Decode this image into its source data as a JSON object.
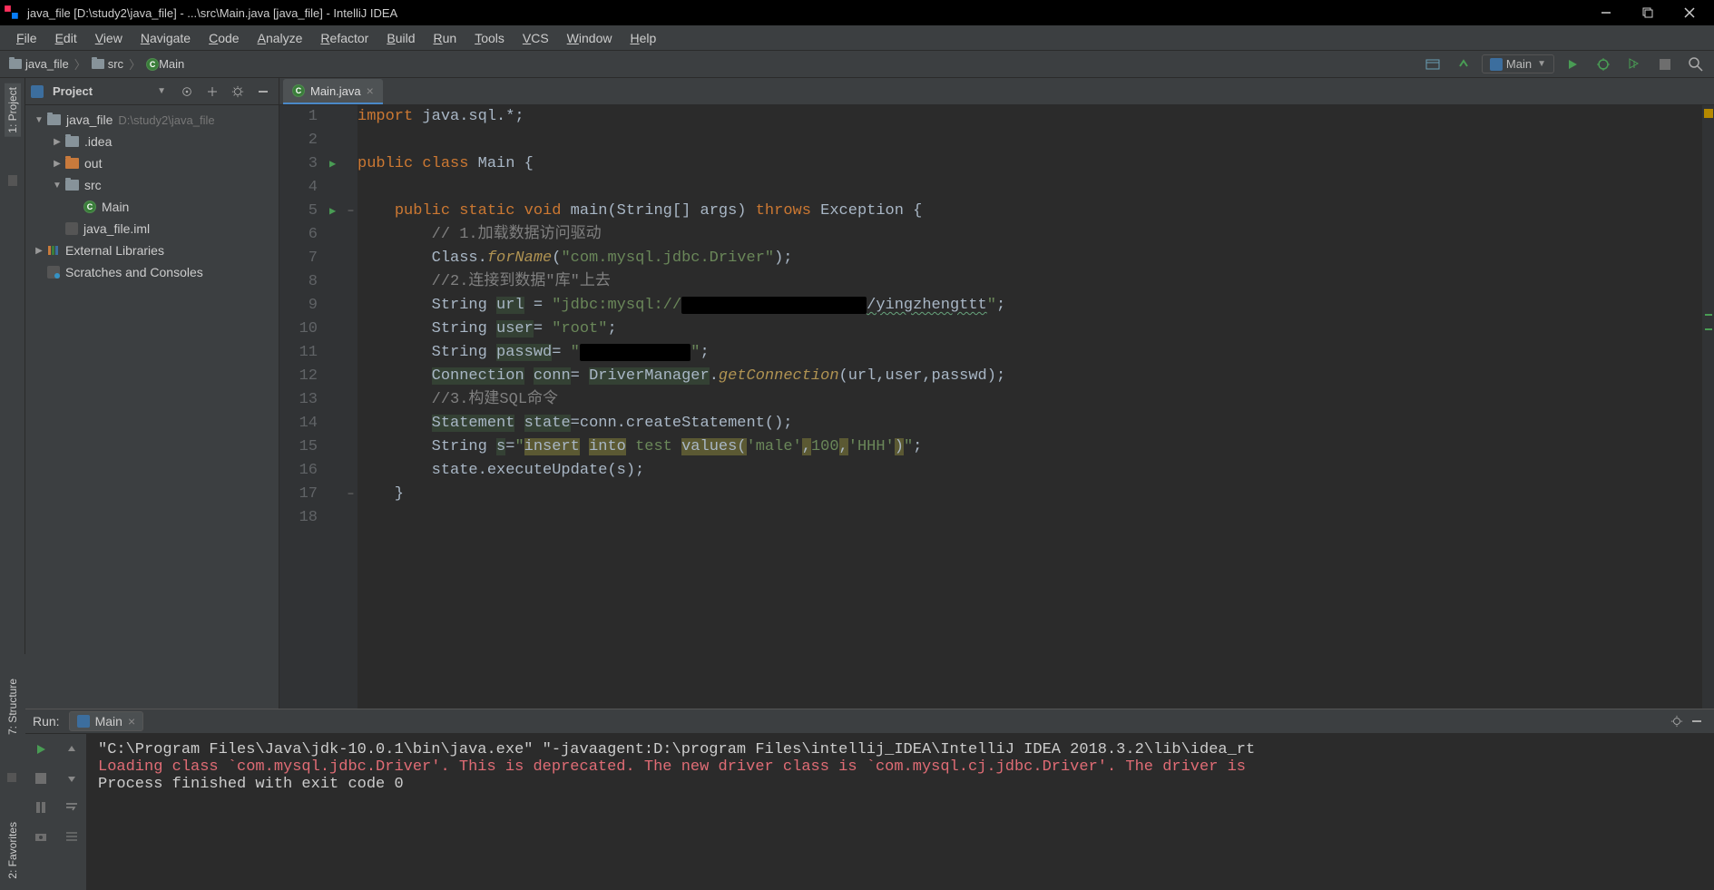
{
  "title": "java_file [D:\\study2\\java_file] - ...\\src\\Main.java [java_file] - IntelliJ IDEA",
  "menu": [
    "File",
    "Edit",
    "View",
    "Navigate",
    "Code",
    "Analyze",
    "Refactor",
    "Build",
    "Run",
    "Tools",
    "VCS",
    "Window",
    "Help"
  ],
  "breadcrumb": [
    {
      "icon": "folder",
      "label": "java_file"
    },
    {
      "icon": "folder",
      "label": "src"
    },
    {
      "icon": "class",
      "label": "Main"
    }
  ],
  "runConfig": "Main",
  "project": {
    "title": "Project",
    "tree": [
      {
        "depth": 0,
        "arrow": "▼",
        "icon": "folder",
        "label": "java_file",
        "suffix": "D:\\study2\\java_file"
      },
      {
        "depth": 1,
        "arrow": "▶",
        "icon": "folder-grey",
        "label": ".idea"
      },
      {
        "depth": 1,
        "arrow": "▶",
        "icon": "folder-orange",
        "label": "out"
      },
      {
        "depth": 1,
        "arrow": "▼",
        "icon": "folder-grey",
        "label": "src"
      },
      {
        "depth": 2,
        "arrow": "",
        "icon": "class",
        "label": "Main"
      },
      {
        "depth": 1,
        "arrow": "",
        "icon": "iml",
        "label": "java_file.iml"
      },
      {
        "depth": 0,
        "arrow": "▶",
        "icon": "lib",
        "label": "External Libraries"
      },
      {
        "depth": 0,
        "arrow": "",
        "icon": "scratch",
        "label": "Scratches and Consoles"
      }
    ]
  },
  "editor": {
    "tab": "Main.java",
    "lines": [
      {
        "n": 1,
        "tokens": [
          [
            "k",
            "import"
          ],
          [
            "",
            " java.sql.*;"
          ]
        ]
      },
      {
        "n": 2,
        "tokens": [
          [
            "",
            ""
          ]
        ]
      },
      {
        "n": 3,
        "run": true,
        "tokens": [
          [
            "k",
            "public"
          ],
          [
            "",
            " "
          ],
          [
            "k",
            "class"
          ],
          [
            "",
            " Main {"
          ]
        ]
      },
      {
        "n": 4,
        "tokens": [
          [
            "",
            ""
          ]
        ]
      },
      {
        "n": 5,
        "run": true,
        "fold": "−",
        "tokens": [
          [
            "",
            "    "
          ],
          [
            "k",
            "public"
          ],
          [
            "",
            " "
          ],
          [
            "k",
            "static"
          ],
          [
            "",
            " "
          ],
          [
            "k",
            "void"
          ],
          [
            "",
            " "
          ],
          [
            "",
            "main"
          ],
          [
            "",
            "(String[] args) "
          ],
          [
            "k",
            "throws"
          ],
          [
            "",
            " Exception {"
          ]
        ]
      },
      {
        "n": 6,
        "tokens": [
          [
            "",
            "        "
          ],
          [
            "cm",
            "// 1.加载数据访问驱动"
          ]
        ]
      },
      {
        "n": 7,
        "tokens": [
          [
            "",
            "        Class."
          ],
          [
            "fn",
            "forName"
          ],
          [
            "",
            "("
          ],
          [
            "st",
            "\"com.mysql.jdbc.Driver\""
          ],
          [
            "",
            ");"
          ]
        ]
      },
      {
        "n": 8,
        "tokens": [
          [
            "",
            "        "
          ],
          [
            "cm",
            "//2.连接到数据\"库\"上去"
          ]
        ]
      },
      {
        "n": 9,
        "tokens": [
          [
            "",
            "        String "
          ],
          [
            "bg-ident",
            "url"
          ],
          [
            "",
            " = "
          ],
          [
            "st",
            "\"jdbc:mysql://"
          ],
          [
            "blk",
            "xxxxxxxxxxxxxxxxxxxx"
          ],
          [
            "wavy",
            "/yingzhengttt"
          ],
          [
            "st",
            "\""
          ],
          [
            "",
            ";"
          ]
        ]
      },
      {
        "n": 10,
        "tokens": [
          [
            "",
            "        String "
          ],
          [
            "bg-ident",
            "user"
          ],
          [
            "",
            "= "
          ],
          [
            "st",
            "\"root\""
          ],
          [
            "",
            ";"
          ]
        ]
      },
      {
        "n": 11,
        "tokens": [
          [
            "",
            "        String "
          ],
          [
            "bg-ident",
            "passwd"
          ],
          [
            "",
            "= "
          ],
          [
            "st",
            "\""
          ],
          [
            "blk",
            "xxxxxxxxxxxx"
          ],
          [
            "st",
            "\""
          ],
          [
            "",
            ";"
          ]
        ]
      },
      {
        "n": 12,
        "tokens": [
          [
            "",
            "        "
          ],
          [
            "bg-ident",
            "Connection"
          ],
          [
            "",
            " "
          ],
          [
            "bg-ident",
            "conn"
          ],
          [
            "",
            "= "
          ],
          [
            "bg-ident",
            "DriverManager"
          ],
          [
            "",
            "."
          ],
          [
            "fn",
            "getConnection"
          ],
          [
            "",
            "(url,user,passwd);"
          ]
        ]
      },
      {
        "n": 13,
        "tokens": [
          [
            "",
            "        "
          ],
          [
            "cm",
            "//3.构建SQL命令"
          ]
        ]
      },
      {
        "n": 14,
        "tokens": [
          [
            "",
            "        "
          ],
          [
            "bg-ident",
            "Statement"
          ],
          [
            "",
            " "
          ],
          [
            "bg-ident",
            "state"
          ],
          [
            "",
            "=conn.createStatement();"
          ]
        ]
      },
      {
        "n": 15,
        "tokens": [
          [
            "",
            "        String "
          ],
          [
            "bg-ident",
            "s"
          ],
          [
            "",
            "="
          ],
          [
            "st",
            "\""
          ],
          [
            "bg-str",
            "insert"
          ],
          [
            "st",
            " "
          ],
          [
            "bg-str",
            "into"
          ],
          [
            "st",
            " test "
          ],
          [
            "bg-str",
            "values("
          ],
          [
            "st",
            "'male'"
          ],
          [
            "bg-str",
            ","
          ],
          [
            "st",
            "100"
          ],
          [
            "bg-str",
            ","
          ],
          [
            "st",
            "'HHH'"
          ],
          [
            "bg-str",
            ")"
          ],
          [
            "st",
            "\""
          ],
          [
            "",
            ";"
          ]
        ]
      },
      {
        "n": 16,
        "tokens": [
          [
            "",
            "        state.executeUpdate(s);"
          ]
        ]
      },
      {
        "n": 17,
        "fold": "−",
        "tokens": [
          [
            "",
            "    }"
          ]
        ]
      },
      {
        "n": 18,
        "tokens": [
          [
            "",
            ""
          ]
        ]
      }
    ]
  },
  "run": {
    "label": "Run:",
    "tab": "Main",
    "console": [
      {
        "cls": "",
        "text": "\"C:\\Program Files\\Java\\jdk-10.0.1\\bin\\java.exe\" \"-javaagent:D:\\program Files\\intellij_IDEA\\IntelliJ IDEA 2018.3.2\\lib\\idea_rt"
      },
      {
        "cls": "red",
        "text": "Loading class `com.mysql.jdbc.Driver'. This is deprecated. The new driver class is `com.mysql.cj.jdbc.Driver'. The driver is"
      },
      {
        "cls": "",
        "text": ""
      },
      {
        "cls": "",
        "text": "Process finished with exit code 0"
      }
    ]
  },
  "sideTabs": {
    "project": "1: Project",
    "structure": "7: Structure",
    "favorites": "2: Favorites"
  }
}
